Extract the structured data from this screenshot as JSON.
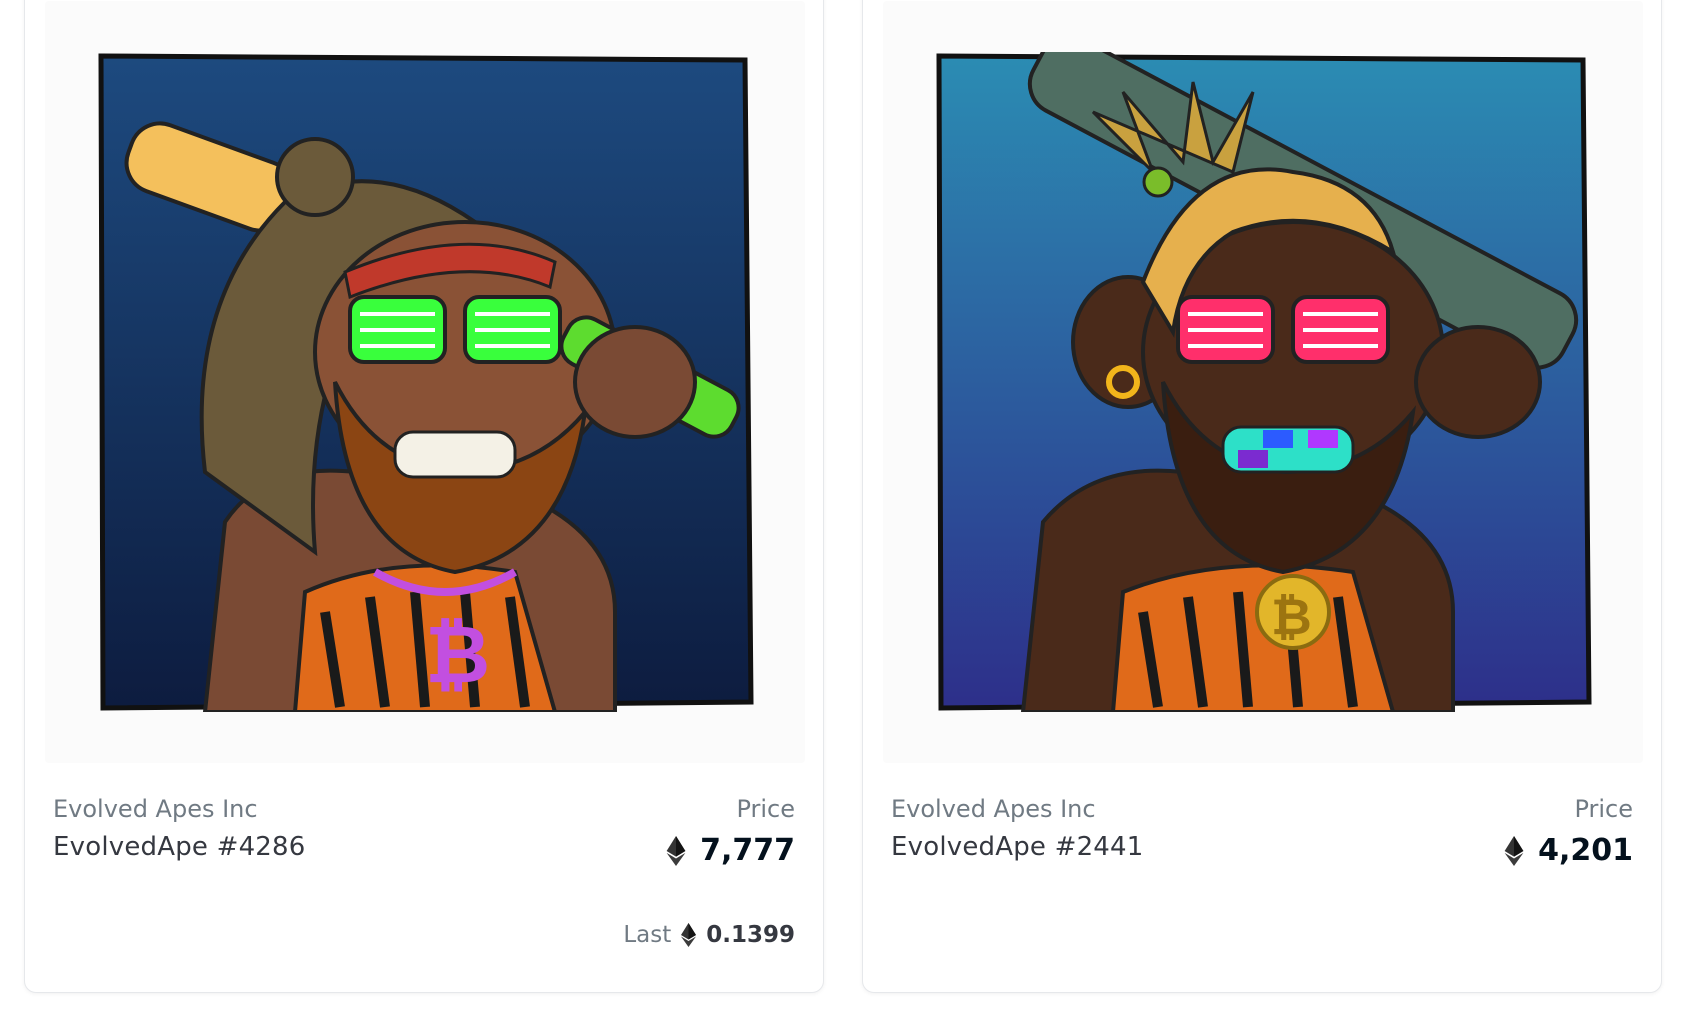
{
  "cards": [
    {
      "collection": "Evolved Apes Inc",
      "name": "EvolvedApe #4286",
      "price_label": "Price",
      "price": "7,777",
      "currency_icon": "ethereum-icon",
      "last_label": "Last",
      "last_price": "0.1399",
      "art": {
        "bg_top": "#1d4a7f",
        "bg_bottom": "#0d1c3f",
        "glasses": "#39ff3c",
        "club": "#f4c05c",
        "pendant": "#c24fe0"
      }
    },
    {
      "collection": "Evolved Apes Inc",
      "name": "EvolvedApe #2441",
      "price_label": "Price",
      "price": "4,201",
      "currency_icon": "ethereum-icon",
      "art": {
        "bg_top": "#2b8cb3",
        "bg_bottom": "#2d2f8a",
        "glasses": "#ff2f6b",
        "club": "#4f6e62",
        "pendant": "#e2b62a"
      }
    }
  ]
}
